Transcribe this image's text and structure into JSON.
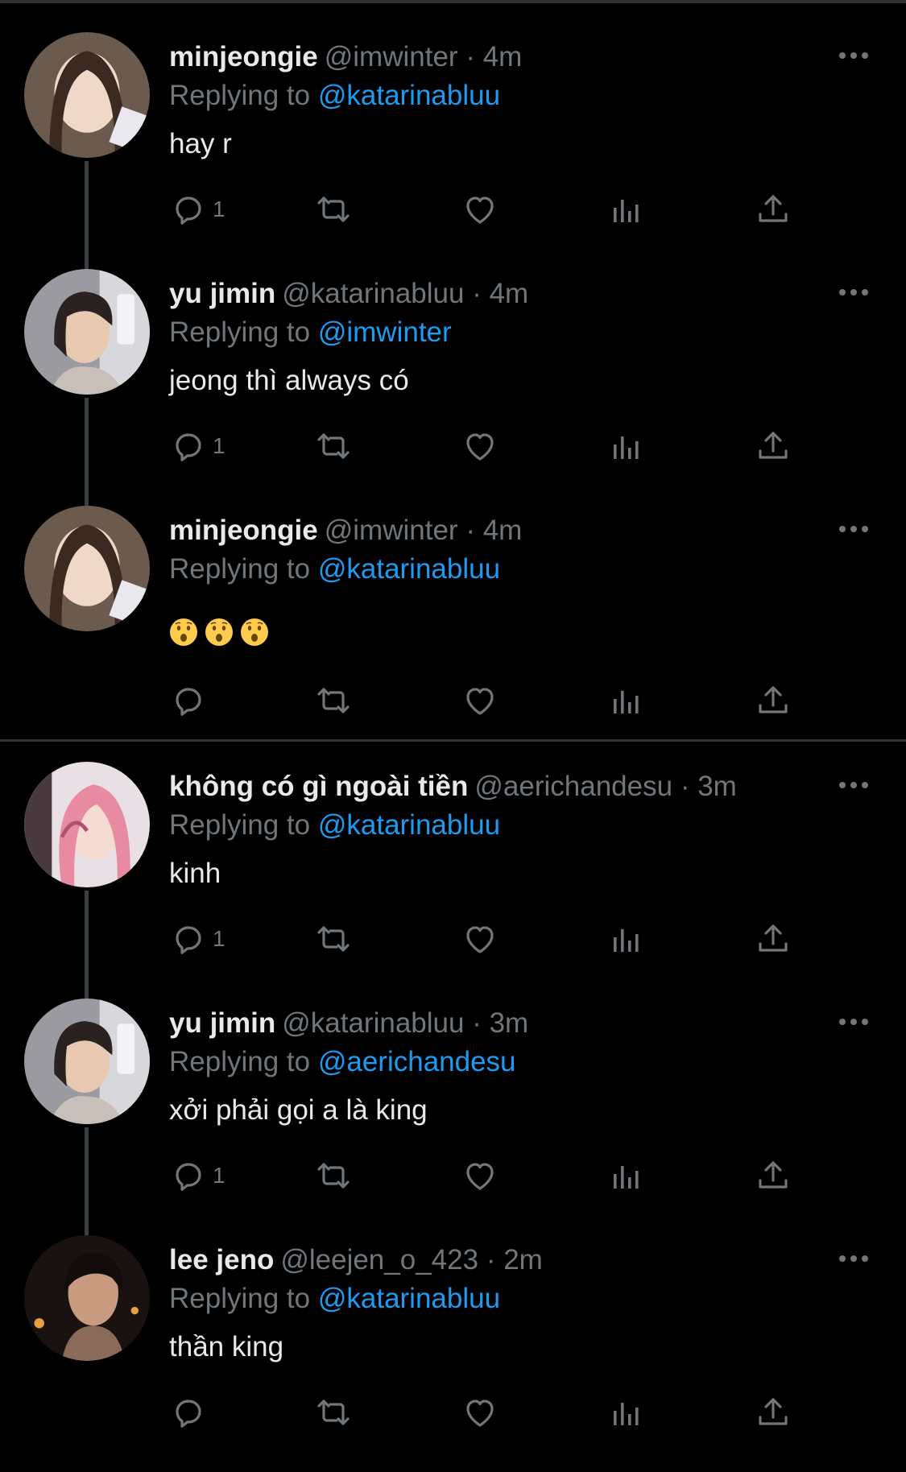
{
  "tweets": [
    {
      "name": "minjeongie",
      "handle": "@imwinter",
      "time": "4m",
      "replying_label": "Replying to",
      "mention": "@katarinabluu",
      "text": "hay r",
      "reply_count": "1"
    },
    {
      "name": "yu jimin",
      "handle": "@katarinabluu",
      "time": "4m",
      "replying_label": "Replying to",
      "mention": "@imwinter",
      "text": "jeong thì always có",
      "reply_count": "1"
    },
    {
      "name": "minjeongie",
      "handle": "@imwinter",
      "time": "4m",
      "replying_label": "Replying to",
      "mention": "@katarinabluu",
      "text": "",
      "emojis": [
        "hushed-face",
        "hushed-face",
        "hushed-face"
      ],
      "reply_count": ""
    },
    {
      "name": "không có gì ngoài tiền",
      "handle": "@aerichandesu",
      "time": "3m",
      "replying_label": "Replying to",
      "mention": "@katarinabluu",
      "text": "kinh",
      "reply_count": "1"
    },
    {
      "name": "yu jimin",
      "handle": "@katarinabluu",
      "time": "3m",
      "replying_label": "Replying to",
      "mention": "@aerichandesu",
      "text": "xởi phải gọi a là king",
      "reply_count": "1"
    },
    {
      "name": "lee jeno",
      "handle": "@leejen_o_423",
      "time": "2m",
      "replying_label": "Replying to",
      "mention": "@katarinabluu",
      "text": "thần king",
      "reply_count": ""
    }
  ],
  "separator": "·",
  "colors": {
    "background": "#000000",
    "text": "#e7e9ea",
    "secondary": "#71767b",
    "link": "#1d9bf0",
    "divider": "#2f3336"
  },
  "icons": [
    "more-icon",
    "reply-icon",
    "retweet-icon",
    "like-icon",
    "views-icon",
    "share-icon"
  ]
}
